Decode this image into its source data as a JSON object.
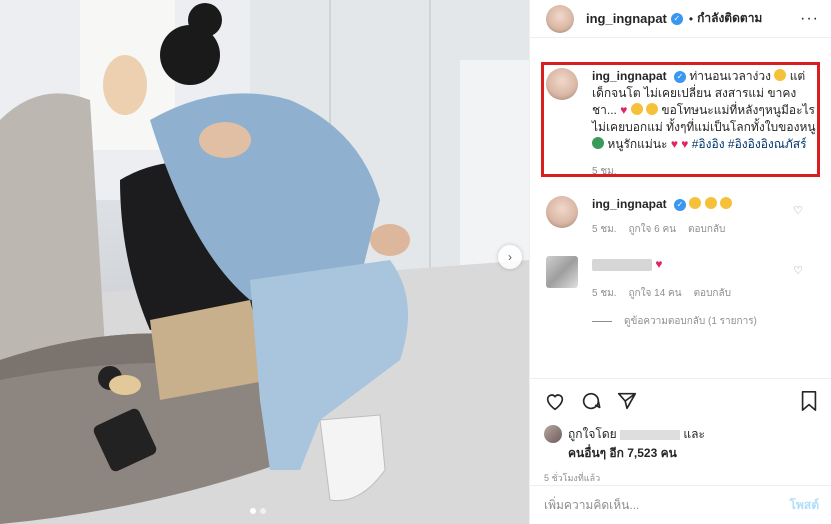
{
  "header": {
    "username": "ing_ingnapat",
    "verified_mark": "✓",
    "separator": "•",
    "follow_label": "กำลังติดตาม",
    "more_label": "···"
  },
  "photo": {
    "carousel_next": "›"
  },
  "caption": {
    "username": "ing_ingnapat",
    "verified_mark": "✓",
    "text_1": " ท่านอนเวลาง่วง ",
    "text_2": " แต่เด็กจนโต ไม่เคยเปลี่ยน สงสารแม่ ขาคงชา...",
    "text_3": " ขอโทษนะแม่ที่หลังๆหนูมีอะไรไม่เคยบอกแม่ ทั้งๆที่แม่เป็นโลกทั้งใบของหนู",
    "text_4": " หนูรักแม่นะ",
    "hashtags": "#อิงอิง #อิงอิงอิงณภัสร์",
    "time": "5 ชม."
  },
  "comments": [
    {
      "username": "ing_ingnapat",
      "verified_mark": "✓",
      "time": "5 ชม.",
      "likes": "ถูกใจ 6 คน",
      "reply": "ตอบกลับ"
    },
    {
      "time": "5 ชม.",
      "likes": "ถูกใจ 14 คน",
      "reply": "ตอบกลับ",
      "view_replies": "ดูข้อความตอบกลับ (1 รายการ)"
    }
  ],
  "likes": {
    "prefix": "ถูกใจโดย",
    "and": " และ",
    "others": "คนอื่นๆ อีก 7,523 คน"
  },
  "time_ago": "5 ชั่วโมงที่แล้ว",
  "add_comment": {
    "placeholder": "เพิ่มความคิดเห็น...",
    "post_label": "โพสต์"
  },
  "colors": {
    "accent_blue": "#3897f0",
    "highlight_red": "#d81e1e",
    "heart_red": "#e0245e"
  }
}
